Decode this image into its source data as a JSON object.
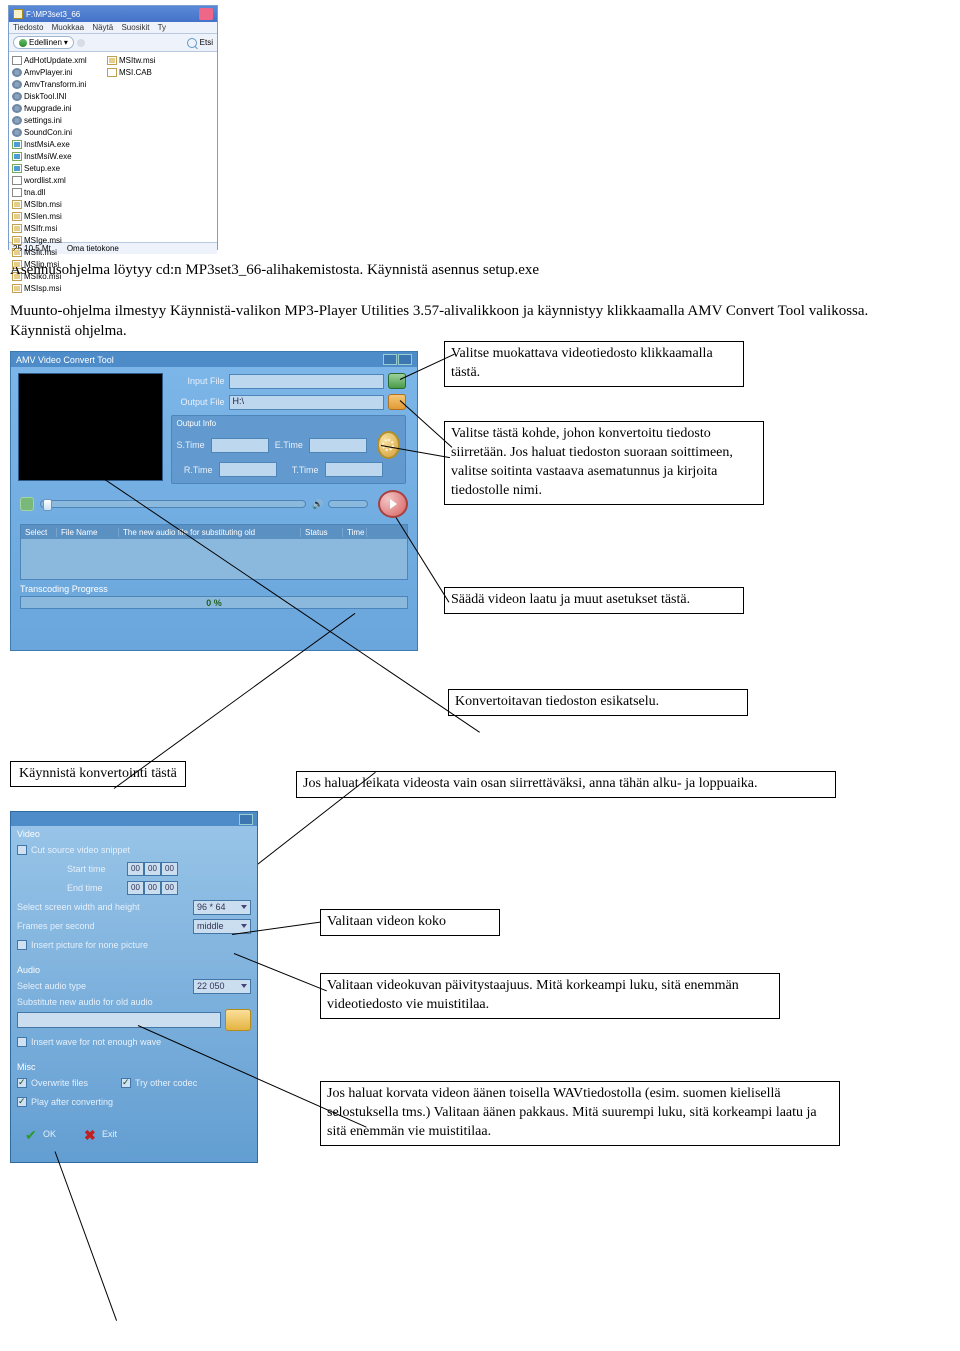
{
  "explorer": {
    "title": "F:\\MP3set3_66",
    "menu": [
      "Tiedosto",
      "Muokkaa",
      "Näytä",
      "Suosikit",
      "Ty"
    ],
    "back": "Edellinen",
    "search": "Etsi",
    "files_col1": [
      {
        "name": "AdHotUpdate.xml",
        "ico": "ico-xml"
      },
      {
        "name": "AmvPlayer.ini",
        "ico": "ico-gear"
      },
      {
        "name": "AmvTransform.ini",
        "ico": "ico-gear"
      },
      {
        "name": "DiskTool.INI",
        "ico": "ico-gear"
      },
      {
        "name": "fwupgrade.ini",
        "ico": "ico-gear"
      },
      {
        "name": "settings.ini",
        "ico": "ico-gear"
      },
      {
        "name": "SoundCon.ini",
        "ico": "ico-gear"
      },
      {
        "name": "InstMsiA.exe",
        "ico": "ico-exe"
      },
      {
        "name": "InstMsiW.exe",
        "ico": "ico-exe"
      },
      {
        "name": "Setup.exe",
        "ico": "ico-exe"
      },
      {
        "name": "wordlist.xml",
        "ico": "ico-xml"
      },
      {
        "name": "tna.dll",
        "ico": "ico-dll"
      },
      {
        "name": "MSIbn.msi",
        "ico": "ico-msi"
      },
      {
        "name": "MSIen.msi",
        "ico": "ico-msi"
      },
      {
        "name": "MSIfr.msi",
        "ico": "ico-msi"
      },
      {
        "name": "MSIge.msi",
        "ico": "ico-msi"
      },
      {
        "name": "MSIit.msi",
        "ico": "ico-msi"
      },
      {
        "name": "MSIjp.msi",
        "ico": "ico-msi"
      },
      {
        "name": "MSIko.msi",
        "ico": "ico-msi"
      },
      {
        "name": "MSIsp.msi",
        "ico": "ico-msi"
      }
    ],
    "files_col2": [
      {
        "name": "MSItw.msi",
        "ico": "ico-msi"
      },
      {
        "name": "MSI.CAB",
        "ico": "ico-cab"
      }
    ],
    "status_left": "25 10.5 Mt",
    "status_right": "Oma tietokone"
  },
  "para": "Asennusohjelma löytyy cd:n MP3set3_66-alihakemistosta. Käynnistä asennus setup.exe\n\nMuunto-ohjelma ilmestyy Käynnistä-valikon MP3-Player Utilities 3.57-alivalikkoon ja käynnistyy klikkaamalla AMV Convert Tool valikossa.\nKäynnistä ohjelma.",
  "amv": {
    "title": "AMV Video Convert Tool",
    "input": "Input File",
    "output": "Output File",
    "output_val": "H:\\",
    "outinfo": "Output Info",
    "stime": "S.Time",
    "etime": "E.Time",
    "rtime": "R.Time",
    "ttime": "T.Time",
    "th1": "Select",
    "th2": "File Name",
    "th3": "The new audio file for substituting old",
    "th4": "Status",
    "th5": "Time",
    "prog": "Transcoding Progress",
    "pct": "0 %"
  },
  "callouts": {
    "c1": "Valitse muokattava videotiedosto klikkaamalla tästä.",
    "c2": "Valitse tästä kohde, johon konvertoitu tiedosto siirretään. Jos haluat tiedoston suoraan soittimeen, valitse soitinta vastaava asematunnus ja kirjoita tiedostolle nimi.",
    "c3": "Säädä videon laatu ja muut asetukset tästä.",
    "c4": "Konvertoitavan tiedoston esikatselu.",
    "c5": "Jos haluat leikata videosta vain osan siirrettäväksi, anna tähän alku- ja loppuaika.",
    "c6": "Käynnistä konvertointi tästä",
    "c7": "Valitaan videon koko",
    "c8": "Valitaan videokuvan päivitystaajuus. Mitä korkeampi luku, sitä enemmän videotiedosto vie muistitilaa.",
    "c9": "Jos haluat korvata videon äänen toisella WAVtiedostolla (esim. suomen kielisellä selostuksella tms.) Valitaan äänen pakkaus. Mitä suurempi luku, sitä korkeampi laatu ja sitä enemmän vie muistitilaa."
  },
  "settings": {
    "video": "Video",
    "cut": "Cut source video snippet",
    "start": "Start time",
    "end": "End time",
    "start_vals": [
      "00",
      "00",
      "00"
    ],
    "end_vals": [
      "00",
      "00",
      "00"
    ],
    "wh": "Select screen width and height",
    "wh_val": "96 * 64",
    "fps": "Frames per second",
    "fps_val": "middle",
    "insert": "Insert picture for none picture",
    "audio": "Audio",
    "atype": "Select audio type",
    "atype_val": "22 050",
    "sub": "Substitute new audio for old audio",
    "wave": "Insert wave for not enough wave",
    "misc": "Misc",
    "over": "Overwrite files",
    "tryc": "Try other codec",
    "play": "Play after converting",
    "ok": "OK",
    "exit": "Exit"
  }
}
